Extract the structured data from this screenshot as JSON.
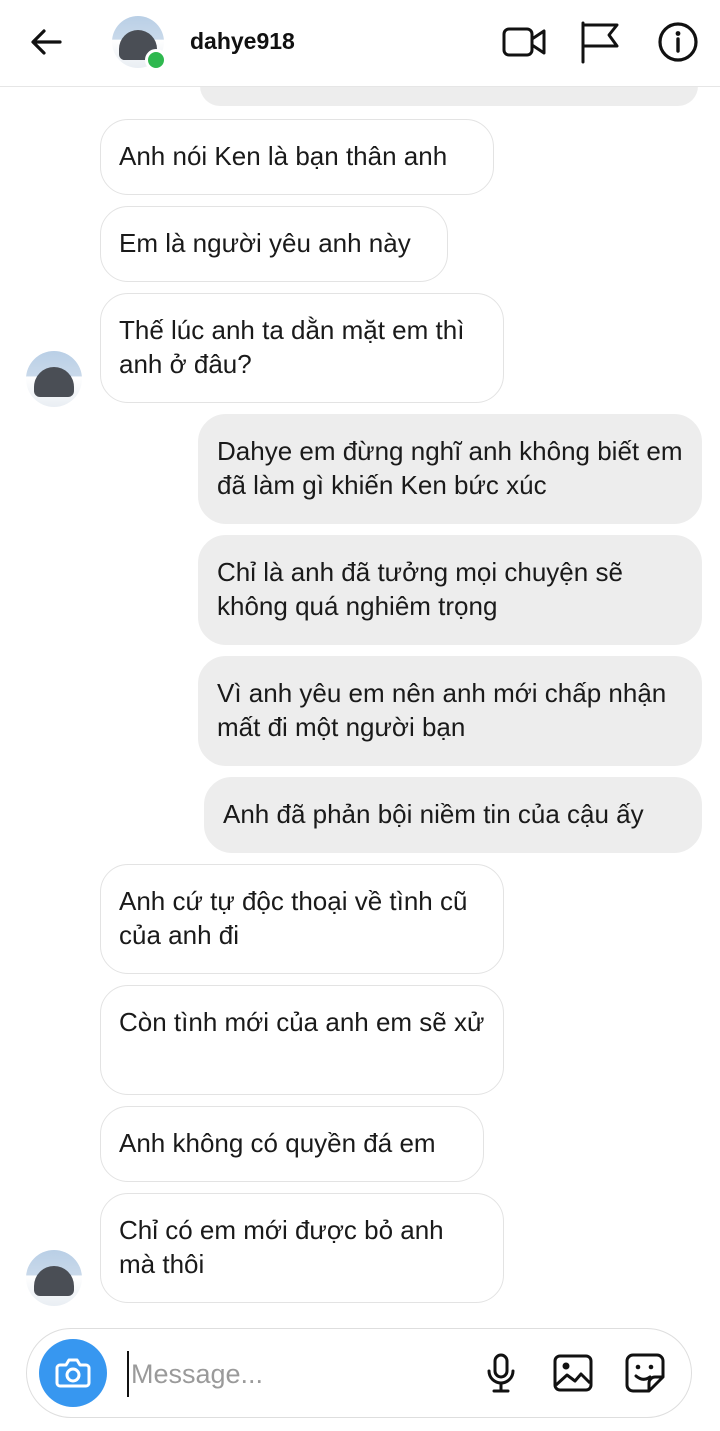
{
  "header": {
    "username": "dahye918",
    "online": true,
    "icons": [
      "back-arrow-icon",
      "video-call-icon",
      "flag-icon",
      "info-icon"
    ]
  },
  "messages": [
    {
      "side": "in",
      "text": "Anh nói Ken là bạn thân anh"
    },
    {
      "side": "in",
      "text": "Em là người yêu anh này"
    },
    {
      "side": "in",
      "text": "Thế lúc anh ta dằn mặt em thì anh ở đâu?"
    },
    {
      "side": "out",
      "text": "Dahye em đừng nghĩ anh không biết em đã làm gì khiến Ken bức xúc"
    },
    {
      "side": "out",
      "text": "Chỉ là anh đã tưởng mọi chuyện sẽ không quá nghiêm trọng"
    },
    {
      "side": "out",
      "text": "Vì anh yêu em nên anh mới chấp nhận mất đi một người bạn"
    },
    {
      "side": "out",
      "text": "Anh đã phản bội niềm tin của cậu ấy"
    },
    {
      "side": "in",
      "text": "Anh cứ tự độc thoại về tình cũ của anh đi"
    },
    {
      "side": "in",
      "text": "Còn tình mới của anh em sẽ xử"
    },
    {
      "side": "in",
      "text": "Anh không có quyền đá em"
    },
    {
      "side": "in",
      "text": "Chỉ có em mới được bỏ anh mà thôi"
    }
  ],
  "composer": {
    "placeholder": "Message...",
    "value": "",
    "icons": [
      "camera-icon",
      "microphone-icon",
      "gallery-icon",
      "sticker-icon"
    ]
  },
  "colors": {
    "accent": "#3797f0",
    "online": "#2fb84f",
    "outgoing_bubble": "#ededed",
    "incoming_border": "#e3e3e3"
  }
}
